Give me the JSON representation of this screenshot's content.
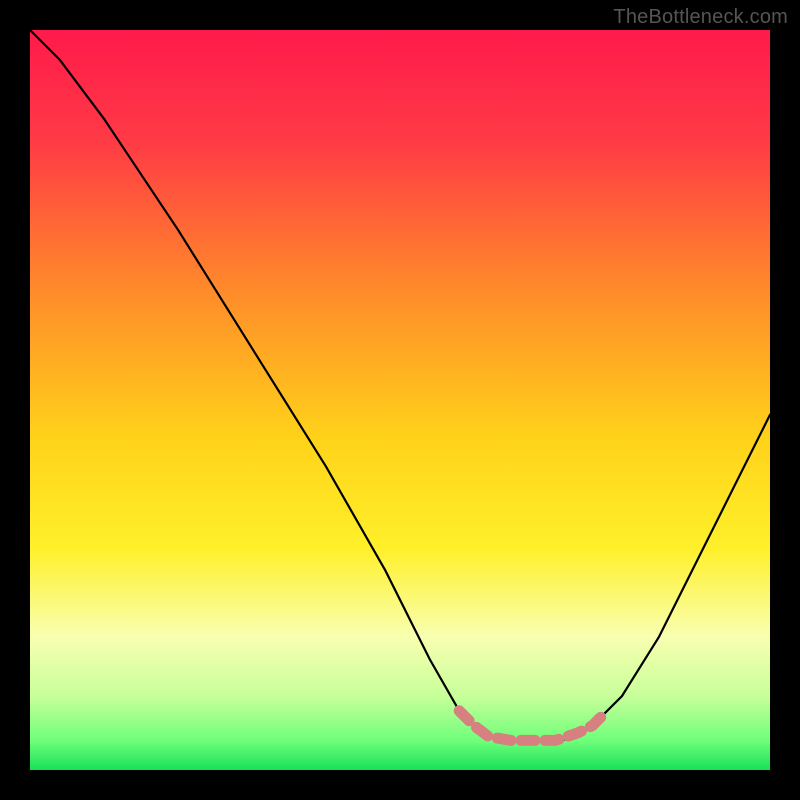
{
  "watermark": "TheBottleneck.com",
  "chart_data": {
    "type": "line",
    "title": "",
    "xlabel": "",
    "ylabel": "",
    "xlim": [
      0,
      100
    ],
    "ylim": [
      0,
      100
    ],
    "gradient_stops": [
      {
        "offset": 0,
        "color": "#ff1a4b"
      },
      {
        "offset": 15,
        "color": "#ff3a45"
      },
      {
        "offset": 35,
        "color": "#ff8a2a"
      },
      {
        "offset": 55,
        "color": "#ffd21a"
      },
      {
        "offset": 70,
        "color": "#fff02a"
      },
      {
        "offset": 82,
        "color": "#f8ffb0"
      },
      {
        "offset": 90,
        "color": "#c8ff9a"
      },
      {
        "offset": 96,
        "color": "#6fff7a"
      },
      {
        "offset": 100,
        "color": "#18e05a"
      }
    ],
    "series": [
      {
        "name": "bottleneck-curve",
        "color": "#000000",
        "points": [
          {
            "x": 0,
            "y": 100
          },
          {
            "x": 4,
            "y": 96
          },
          {
            "x": 10,
            "y": 88
          },
          {
            "x": 20,
            "y": 73
          },
          {
            "x": 30,
            "y": 57
          },
          {
            "x": 40,
            "y": 41
          },
          {
            "x": 48,
            "y": 27
          },
          {
            "x": 54,
            "y": 15
          },
          {
            "x": 58,
            "y": 8
          },
          {
            "x": 61,
            "y": 5
          },
          {
            "x": 64,
            "y": 4
          },
          {
            "x": 68,
            "y": 4
          },
          {
            "x": 72,
            "y": 4
          },
          {
            "x": 76,
            "y": 6
          },
          {
            "x": 80,
            "y": 10
          },
          {
            "x": 85,
            "y": 18
          },
          {
            "x": 90,
            "y": 28
          },
          {
            "x": 95,
            "y": 38
          },
          {
            "x": 100,
            "y": 48
          }
        ]
      },
      {
        "name": "optimal-zone-highlight",
        "color": "#d68080",
        "points": [
          {
            "x": 58,
            "y": 8
          },
          {
            "x": 60,
            "y": 6
          },
          {
            "x": 62,
            "y": 4.5
          },
          {
            "x": 65,
            "y": 4
          },
          {
            "x": 68,
            "y": 4
          },
          {
            "x": 71,
            "y": 4
          },
          {
            "x": 74,
            "y": 5
          },
          {
            "x": 76,
            "y": 6
          },
          {
            "x": 78,
            "y": 8
          }
        ]
      }
    ]
  }
}
